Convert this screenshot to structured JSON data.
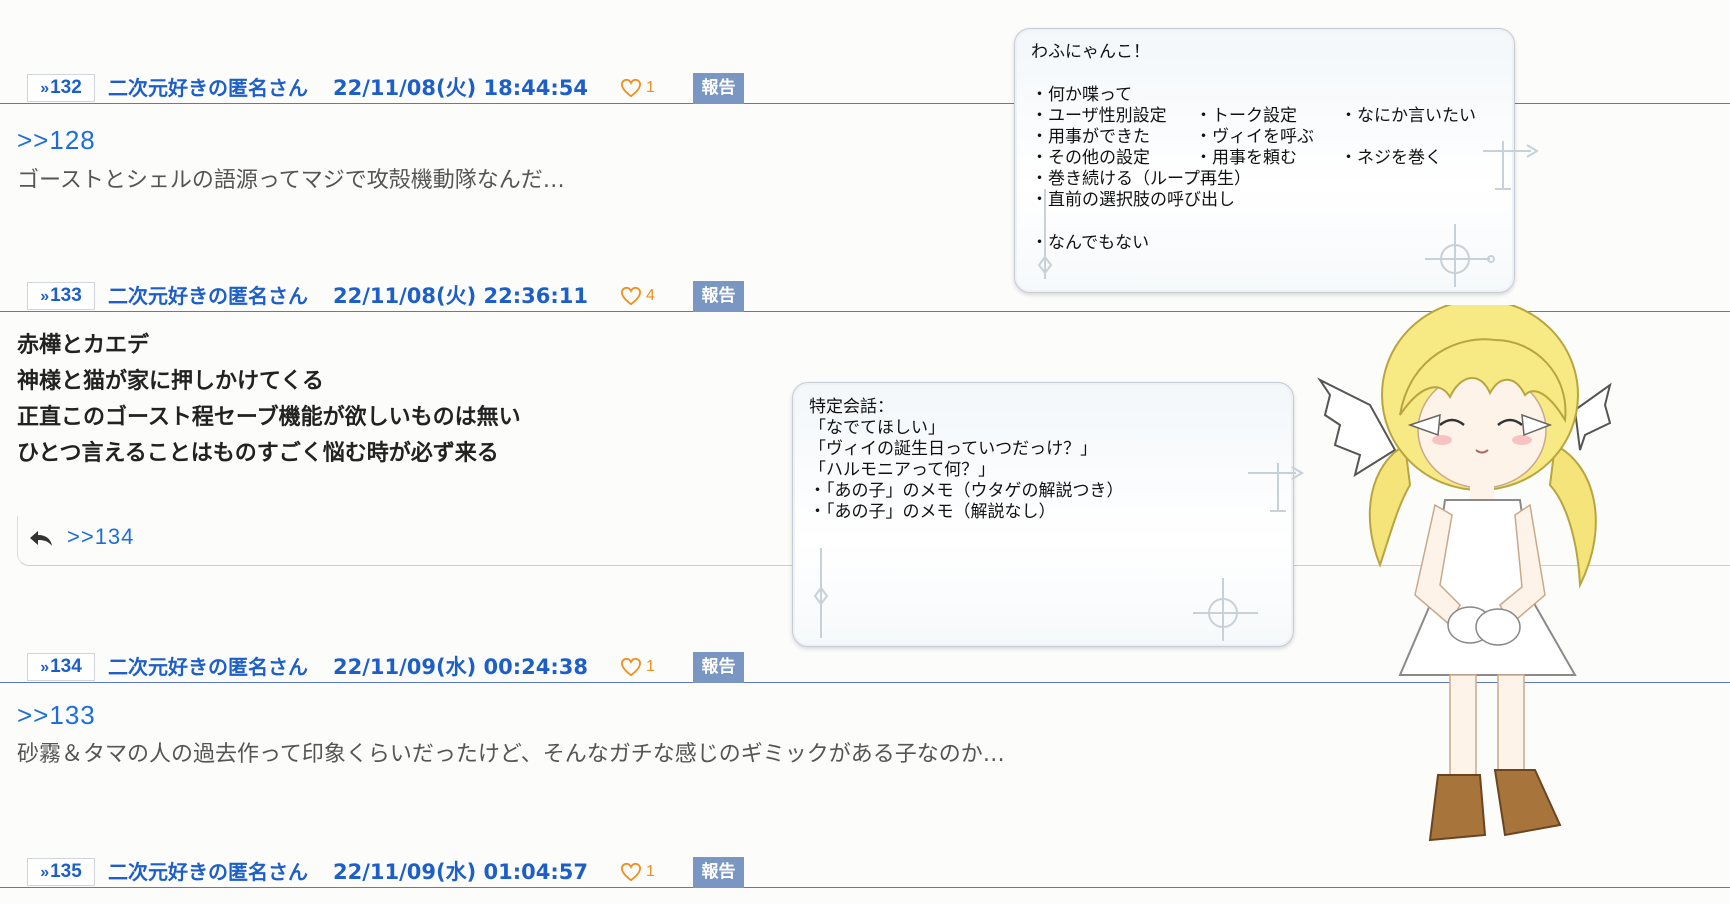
{
  "posts": [
    {
      "num": "132",
      "name": "二次元好きの匿名さん",
      "date": "22/11/08(火) 18:44:54",
      "likes": "1",
      "report": "報告",
      "anchor": ">>128",
      "text": "ゴーストとシェルの語源ってマジで攻殻機動隊なんだ…"
    },
    {
      "num": "133",
      "name": "二次元好きの匿名さん",
      "date": "22/11/08(火) 22:36:11",
      "likes": "4",
      "report": "報告",
      "lines": [
        "赤樺とカエデ",
        "神様と猫が家に押しかけてくる",
        "正直このゴースト程セーブ機能が欲しいものは無い",
        "ひとつ言えることはものすごく悩む時が必ず来る"
      ],
      "reply_link": ">>134"
    },
    {
      "num": "134",
      "name": "二次元好きの匿名さん",
      "date": "22/11/09(水) 00:24:38",
      "likes": "1",
      "report": "報告",
      "anchor": ">>133",
      "text": "砂霧＆タマの人の過去作って印象くらいだったけど、そんなガチな感じのギミックがある子なのか…"
    },
    {
      "num": "135",
      "name": "二次元好きの匿名さん",
      "date": "22/11/09(水) 01:04:57",
      "likes": "1",
      "report": "報告"
    }
  ],
  "balloon_main": {
    "greeting": "わふにゃんこ！",
    "items": {
      "talk": "・何か喋って",
      "gender": "・ユーザ性別設定",
      "talk_settings": "・トーク設定",
      "say_something": "・なにか言いたい",
      "errand_done": "・用事ができた",
      "call_vy": "・ヴィイを呼ぶ",
      "other_settings": "・その他の設定",
      "ask_errand": "・用事を頼む",
      "wind_spring": "・ネジを巻く",
      "keep_winding": "・巻き続ける（ループ再生）",
      "prev_choice": "・直前の選択肢の呼び出し",
      "nothing": "・なんでもない"
    }
  },
  "balloon_sub": {
    "title": "特定会話：",
    "items": [
      "「なでてほしい」",
      "「ヴィイの誕生日っていつだっけ？」",
      "「ハルモニアって何？」",
      "・「あの子」のメモ（ウタゲの解説つき）",
      "・「あの子」のメモ（解説なし）"
    ]
  },
  "colors": {
    "accent": "#1d5fc8",
    "like": "#ef8f1e",
    "report_bg": "#7a97c4",
    "divider": "#5a78c8"
  }
}
